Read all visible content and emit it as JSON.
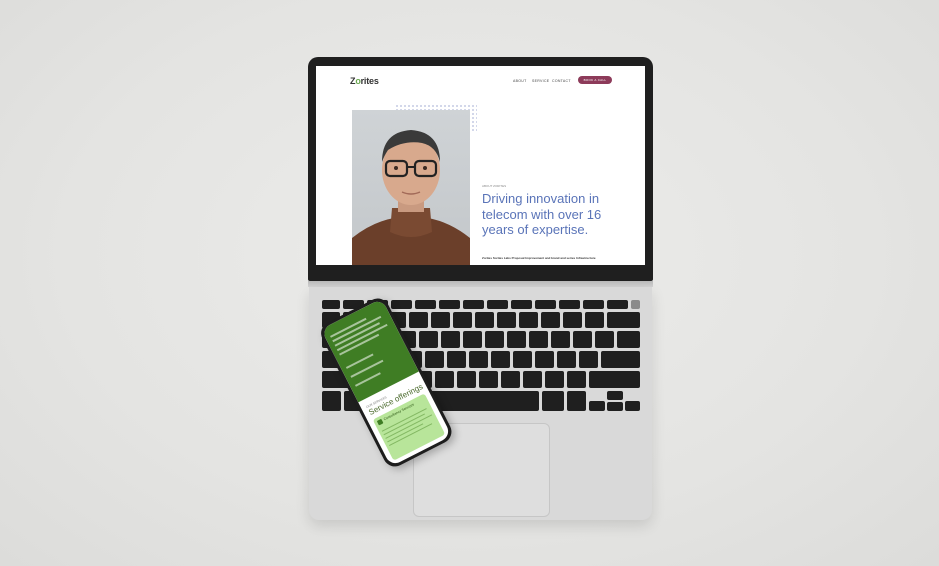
{
  "website": {
    "logo": "Zorites",
    "nav": [
      "ABOUT",
      "SERVICE",
      "CONTACT"
    ],
    "cta": "BOOK A CALL",
    "eyebrow": "ABOUT ZORITES",
    "headline": "Driving innovation in telecom with over 16 years of expertise.",
    "subline": "Zorites Sorties Labs Proposal Improvement and brand and series Infrastructure"
  },
  "phone": {
    "section_label": "OUR SERVICES",
    "title": "Service offerings",
    "card_title": "Consultancy Services"
  },
  "colors": {
    "accent_blue": "#5a74b8",
    "cta": "#8d3b5a",
    "phone_green": "#3f7d24",
    "card_green": "#b8e59a"
  }
}
